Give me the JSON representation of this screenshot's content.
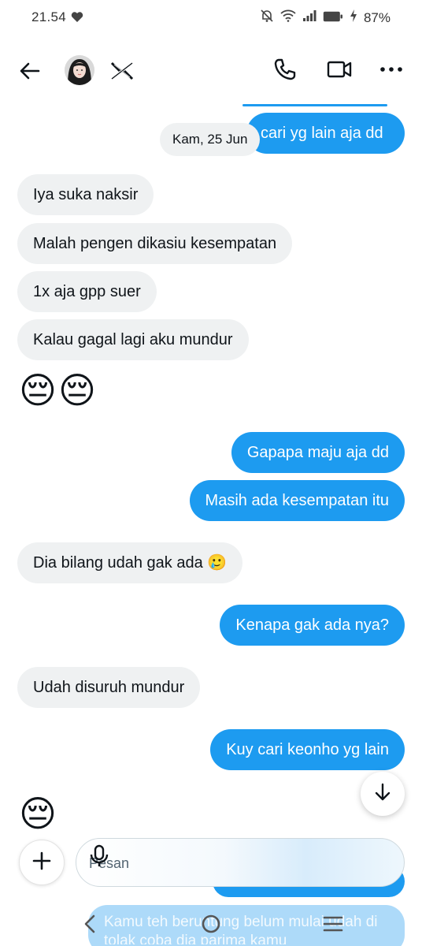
{
  "status_bar": {
    "time": "21.54",
    "battery": "87%"
  },
  "header": {
    "contact_avatar_alt": "",
    "call_icon": "phone-icon",
    "video_icon": "video-icon",
    "more_icon": "more-icon"
  },
  "conversation": {
    "top_partial_out": "cari yg lain aja dd",
    "date_separator": "Kam, 25 Jun",
    "messages": [
      {
        "dir": "in",
        "text": "Iya suka naksir"
      },
      {
        "dir": "in",
        "text": "Malah pengen dikasiu kesempatan"
      },
      {
        "dir": "in",
        "text": "1x aja gpp suer"
      },
      {
        "dir": "in",
        "text": "Kalau gagal lagi aku mundur"
      },
      {
        "dir": "in",
        "emoji": "😔😔"
      },
      {
        "dir": "out",
        "text": "Gapapa maju aja dd"
      },
      {
        "dir": "out",
        "text": "Masih ada kesempatan itu"
      },
      {
        "dir": "in",
        "text": "Dia bilang udah gak ada 🥲"
      },
      {
        "dir": "out",
        "text": "Kenapa gak ada nya?"
      },
      {
        "dir": "in",
        "text": "Udah disuruh mundur"
      },
      {
        "dir": "out",
        "text": "Kuy cari keonho yg lain"
      },
      {
        "dir": "in",
        "emoji": "😔"
      }
    ],
    "underlay_text": "Kamu teh beruntung belum mulai udah di tolak coba dia parima kamu"
  },
  "composer": {
    "placeholder": "Pesan"
  },
  "colors": {
    "accent": "#1d9bf0",
    "incoming": "#eff1f2"
  }
}
